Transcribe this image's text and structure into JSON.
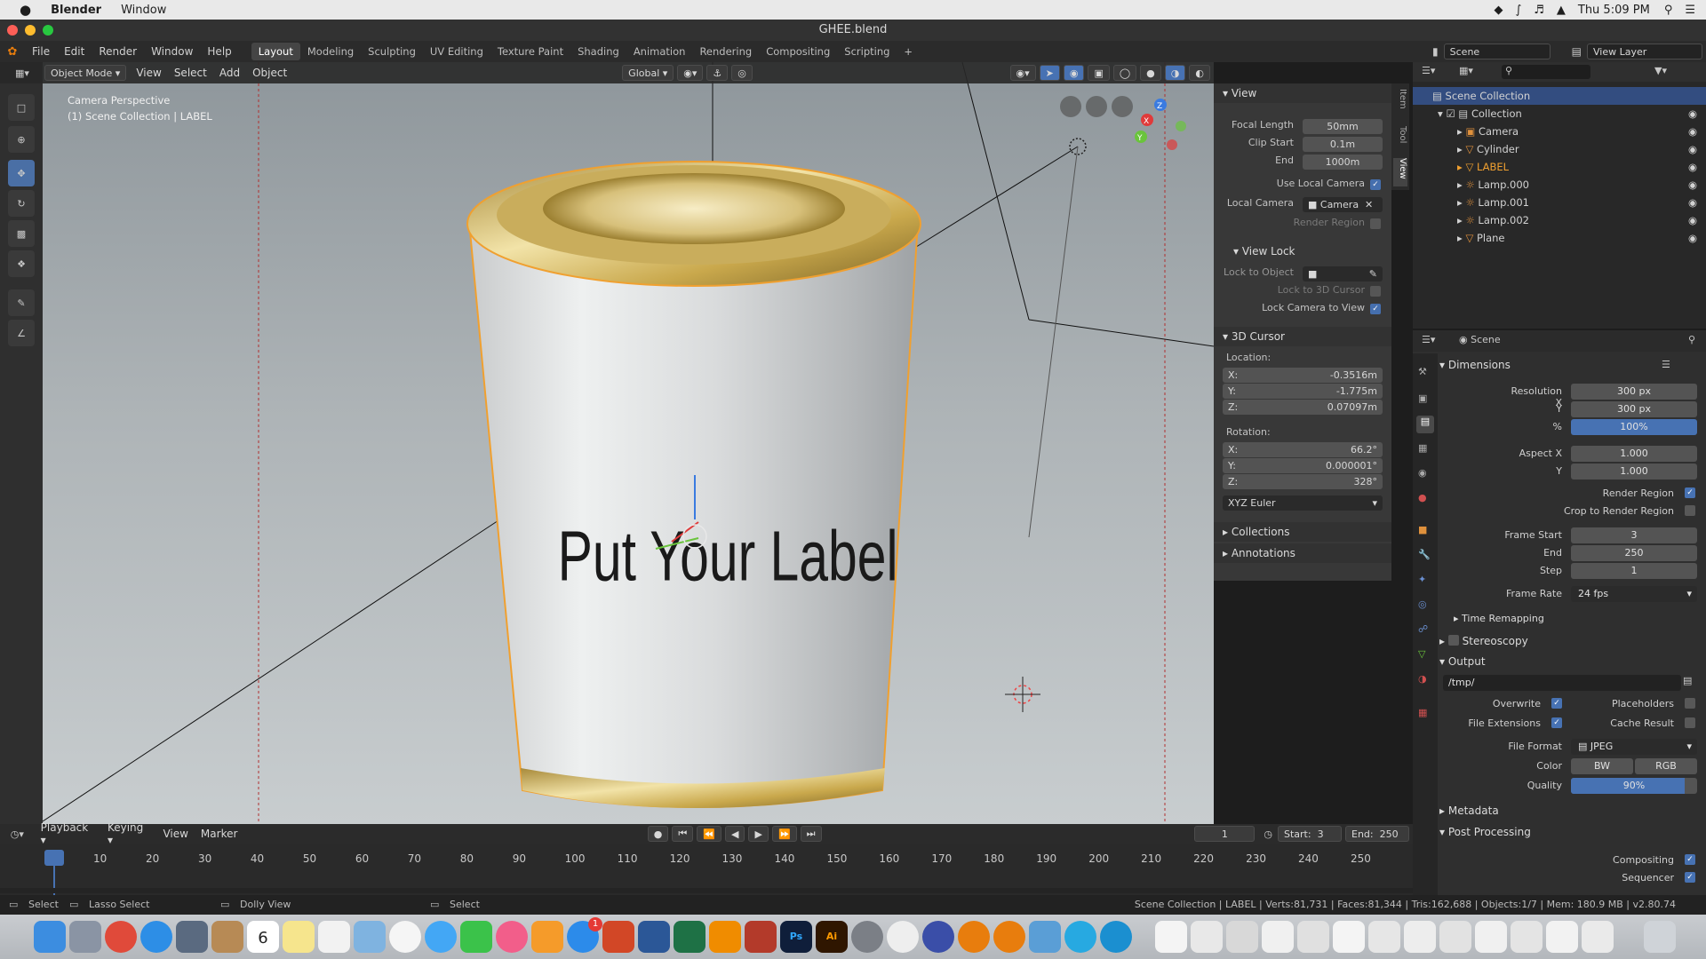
{
  "mac_menubar": {
    "apple": "",
    "app": "Blender",
    "menu": "Window",
    "clock": "Thu 5:09 PM"
  },
  "window": {
    "title": "GHEE.blend"
  },
  "top_menu": [
    "File",
    "Edit",
    "Render",
    "Window",
    "Help"
  ],
  "workspaces": [
    "Layout",
    "Modeling",
    "Sculpting",
    "UV Editing",
    "Texture Paint",
    "Shading",
    "Animation",
    "Rendering",
    "Compositing",
    "Scripting"
  ],
  "active_workspace": "Layout",
  "scene_name": "Scene",
  "view_layer": "View Layer",
  "viewport_header": {
    "mode": "Object Mode",
    "menus": [
      "View",
      "Select",
      "Add",
      "Object"
    ],
    "transform": "Global"
  },
  "viewport_overlay": {
    "line1": "Camera Perspective",
    "line2": "(1) Scene Collection | LABEL"
  },
  "label_text": "Put Your Label",
  "npanel": {
    "tabs": [
      "Item",
      "Tool",
      "View"
    ],
    "view_title": "View",
    "focal_length_label": "Focal Length",
    "focal_length": "50mm",
    "clip_start_label": "Clip Start",
    "clip_start": "0.1m",
    "clip_end_label": "End",
    "clip_end": "1000m",
    "use_local_camera": "Use Local Camera",
    "local_camera_label": "Local Camera",
    "local_camera": "Camera",
    "render_region": "Render Region",
    "view_lock_title": "View Lock",
    "lock_to_object": "Lock to Object",
    "lock_to_3d_cursor": "Lock to 3D Cursor",
    "lock_camera_to_view": "Lock Camera to View",
    "cursor_title": "3D Cursor",
    "location_label": "Location:",
    "loc_x": "-0.3516m",
    "loc_y": "-1.775m",
    "loc_z": "0.07097m",
    "rotation_label": "Rotation:",
    "rot_x": "66.2°",
    "rot_y": "0.000001°",
    "rot_z": "328°",
    "rotation_mode": "XYZ Euler",
    "collections": "Collections",
    "annotations": "Annotations"
  },
  "outliner": {
    "root": "Scene Collection",
    "collection": "Collection",
    "items": [
      "Camera",
      "Cylinder",
      "LABEL",
      "Lamp.000",
      "Lamp.001",
      "Lamp.002",
      "Plane"
    ]
  },
  "properties": {
    "context": "Scene",
    "dimensions": "Dimensions",
    "res_x_label": "Resolution X",
    "res_x": "300 px",
    "res_y_label": "Y",
    "res_y": "300 px",
    "res_pct_label": "%",
    "res_pct": "100%",
    "aspect_x_label": "Aspect X",
    "aspect_x": "1.000",
    "aspect_y_label": "Y",
    "aspect_y": "1.000",
    "render_region": "Render Region",
    "crop_region": "Crop to Render Region",
    "frame_start_label": "Frame Start",
    "frame_start": "3",
    "frame_end_label": "End",
    "frame_end": "250",
    "frame_step_label": "Step",
    "frame_step": "1",
    "frame_rate_label": "Frame Rate",
    "frame_rate": "24 fps",
    "time_remapping": "Time Remapping",
    "stereoscopy": "Stereoscopy",
    "output": "Output",
    "output_path": "/tmp/",
    "overwrite": "Overwrite",
    "placeholders": "Placeholders",
    "file_extensions": "File Extensions",
    "cache_result": "Cache Result",
    "file_format_label": "File Format",
    "file_format": "JPEG",
    "color_label": "Color",
    "color_bw": "BW",
    "color_rgb": "RGB",
    "quality_label": "Quality",
    "quality": "90%",
    "metadata": "Metadata",
    "post_processing": "Post Processing",
    "compositing": "Compositing",
    "sequencer": "Sequencer"
  },
  "timeline": {
    "menus": [
      "Playback",
      "Keying",
      "View",
      "Marker"
    ],
    "current_frame": "1",
    "start_label": "Start:",
    "start": "3",
    "end_label": "End:",
    "end": "250",
    "ticks": [
      "1",
      "10",
      "20",
      "30",
      "40",
      "50",
      "60",
      "70",
      "80",
      "90",
      "100",
      "110",
      "120",
      "130",
      "140",
      "150",
      "160",
      "170",
      "180",
      "190",
      "200",
      "210",
      "220",
      "230",
      "240",
      "250"
    ]
  },
  "statusbar": {
    "select": "Select",
    "lasso": "Lasso Select",
    "dolly": "Dolly View",
    "select2": "Select",
    "info": "Scene Collection | LABEL | Verts:81,731 | Faces:81,344 | Tris:162,688 | Objects:1/7 | Mem: 180.9 MB | v2.80.74"
  },
  "dock": {
    "calendar_day": "6",
    "badge": "1"
  },
  "colors": {
    "accent": "#4772b3",
    "selection_outline": "#f0a030",
    "gold": "#c8a540"
  }
}
